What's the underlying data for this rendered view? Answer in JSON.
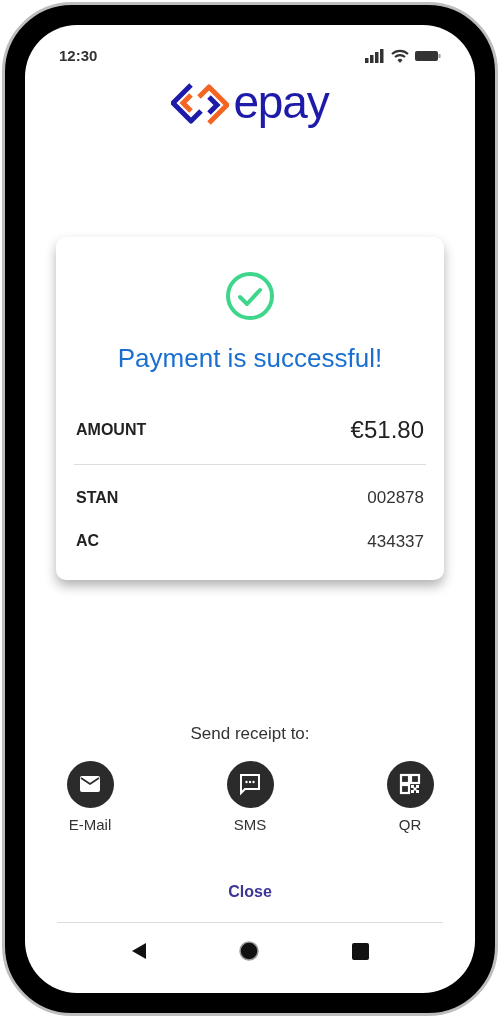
{
  "status_bar": {
    "time": "12:30"
  },
  "logo": {
    "text": "epay"
  },
  "result": {
    "title": "Payment is successful!",
    "amount_label": "AMOUNT",
    "amount": "€51.80",
    "details": [
      {
        "label": "STAN",
        "value": "002878"
      },
      {
        "label": "AC",
        "value": "434337"
      }
    ]
  },
  "receipt": {
    "heading": "Send receipt to:",
    "options": [
      {
        "kind": "email",
        "label": "E-Mail"
      },
      {
        "kind": "sms",
        "label": "SMS"
      },
      {
        "kind": "qr",
        "label": "QR"
      }
    ]
  },
  "close_button": "Close"
}
